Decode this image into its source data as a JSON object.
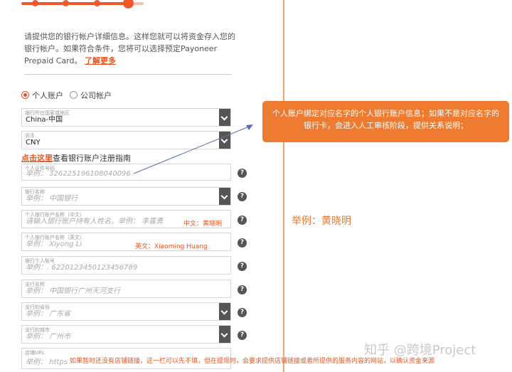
{
  "intro": {
    "text": "请提供您的银行帐户详细信息。这样您就可以将资金存入您的银行帐户。如果符合条件，您将可以选择预定Payoneer Prepaid Card。",
    "link": "了解更多"
  },
  "account_type": {
    "personal": "个人账户",
    "company": "公司帐户",
    "selected": "个人账户"
  },
  "fields": {
    "country": {
      "label": "银行所在国家或地区",
      "value": "China-中国"
    },
    "currency": {
      "label": "货币",
      "value": "CNY"
    },
    "guide": {
      "link": "点击这里",
      "text": "查看银行账户注册指南"
    },
    "id_number": {
      "label": "个人证件号码",
      "placeholder": "举例： 326225196108040096"
    },
    "bank_name": {
      "label": "银行名称",
      "placeholder": "举例： 中国银行"
    },
    "holder_cn": {
      "label": "个人银行账户名称（中文）",
      "placeholder": "请输入银行账户持有人姓名。举例： 李嘉勇",
      "note": "中文：黄晓明"
    },
    "holder_en": {
      "label": "个人银行账户名称（英文）",
      "placeholder": "举例： Xiyong Li",
      "note": "英文：Xiaoming Huang"
    },
    "account_no": {
      "label": "银行个人账号",
      "placeholder": "举例：. 6220123450123456789"
    },
    "branch": {
      "label": "支行名称",
      "placeholder": "举例： 中国银行广州天河支行"
    },
    "province": {
      "label": "支行的省份",
      "placeholder": "举例： 广东省"
    },
    "city": {
      "label": "支行的城市",
      "placeholder": "举例： 广州市"
    },
    "store_url": {
      "label": "店铺URL",
      "placeholder": "举例： https"
    }
  },
  "help_symbol": "?",
  "callout": "个人账户绑定对应名字的个人银行账户信息；如果不是对应名字的银行卡，会进入人工审核阶段，提供关系说明；",
  "example": "举例：黄晓明",
  "bottom_note": "如果暂时还没有店铺链接，这一栏可以先不填，但在提现时，会要求提供店铺链接或者所提供的服务内容的网站，以确认资金来源",
  "watermark": "知乎 @跨境Project",
  "colors": {
    "accent": "#e8541f",
    "callout": "#ef7b30"
  }
}
